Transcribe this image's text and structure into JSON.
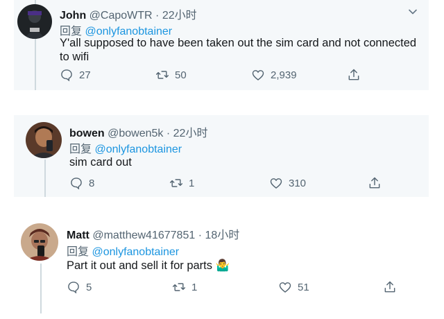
{
  "tweets": [
    {
      "name": "John",
      "handle": "@CapoWTR",
      "sep": "·",
      "time": "22小时",
      "reply_prefix": "回复",
      "reply_to": "@onlyfanobtainer",
      "text": "Y'all supposed to have been taken out the sim card and not connected to wifi",
      "replies": "27",
      "retweets": "50",
      "likes": "2,939"
    },
    {
      "name": "bowen",
      "handle": "@bowen5k",
      "sep": "·",
      "time": "22小时",
      "reply_prefix": "回复",
      "reply_to": "@onlyfanobtainer",
      "text": "sim card out",
      "replies": "8",
      "retweets": "1",
      "likes": "310"
    },
    {
      "name": "Matt",
      "handle": "@matthew41677851",
      "sep": "·",
      "time": "18小时",
      "reply_prefix": "回复",
      "reply_to": "@onlyfanobtainer",
      "text": "Part it out and sell it for parts",
      "emoji": "🤷‍♂️",
      "replies": "5",
      "retweets": "1",
      "likes": "51"
    }
  ],
  "icons": {
    "reply": "reply-icon",
    "retweet": "retweet-icon",
    "like": "heart-icon",
    "share": "share-icon",
    "more": "chevron-down-icon"
  },
  "colors": {
    "link": "#1b95e0",
    "secondary": "#536471",
    "text": "#14171a"
  }
}
